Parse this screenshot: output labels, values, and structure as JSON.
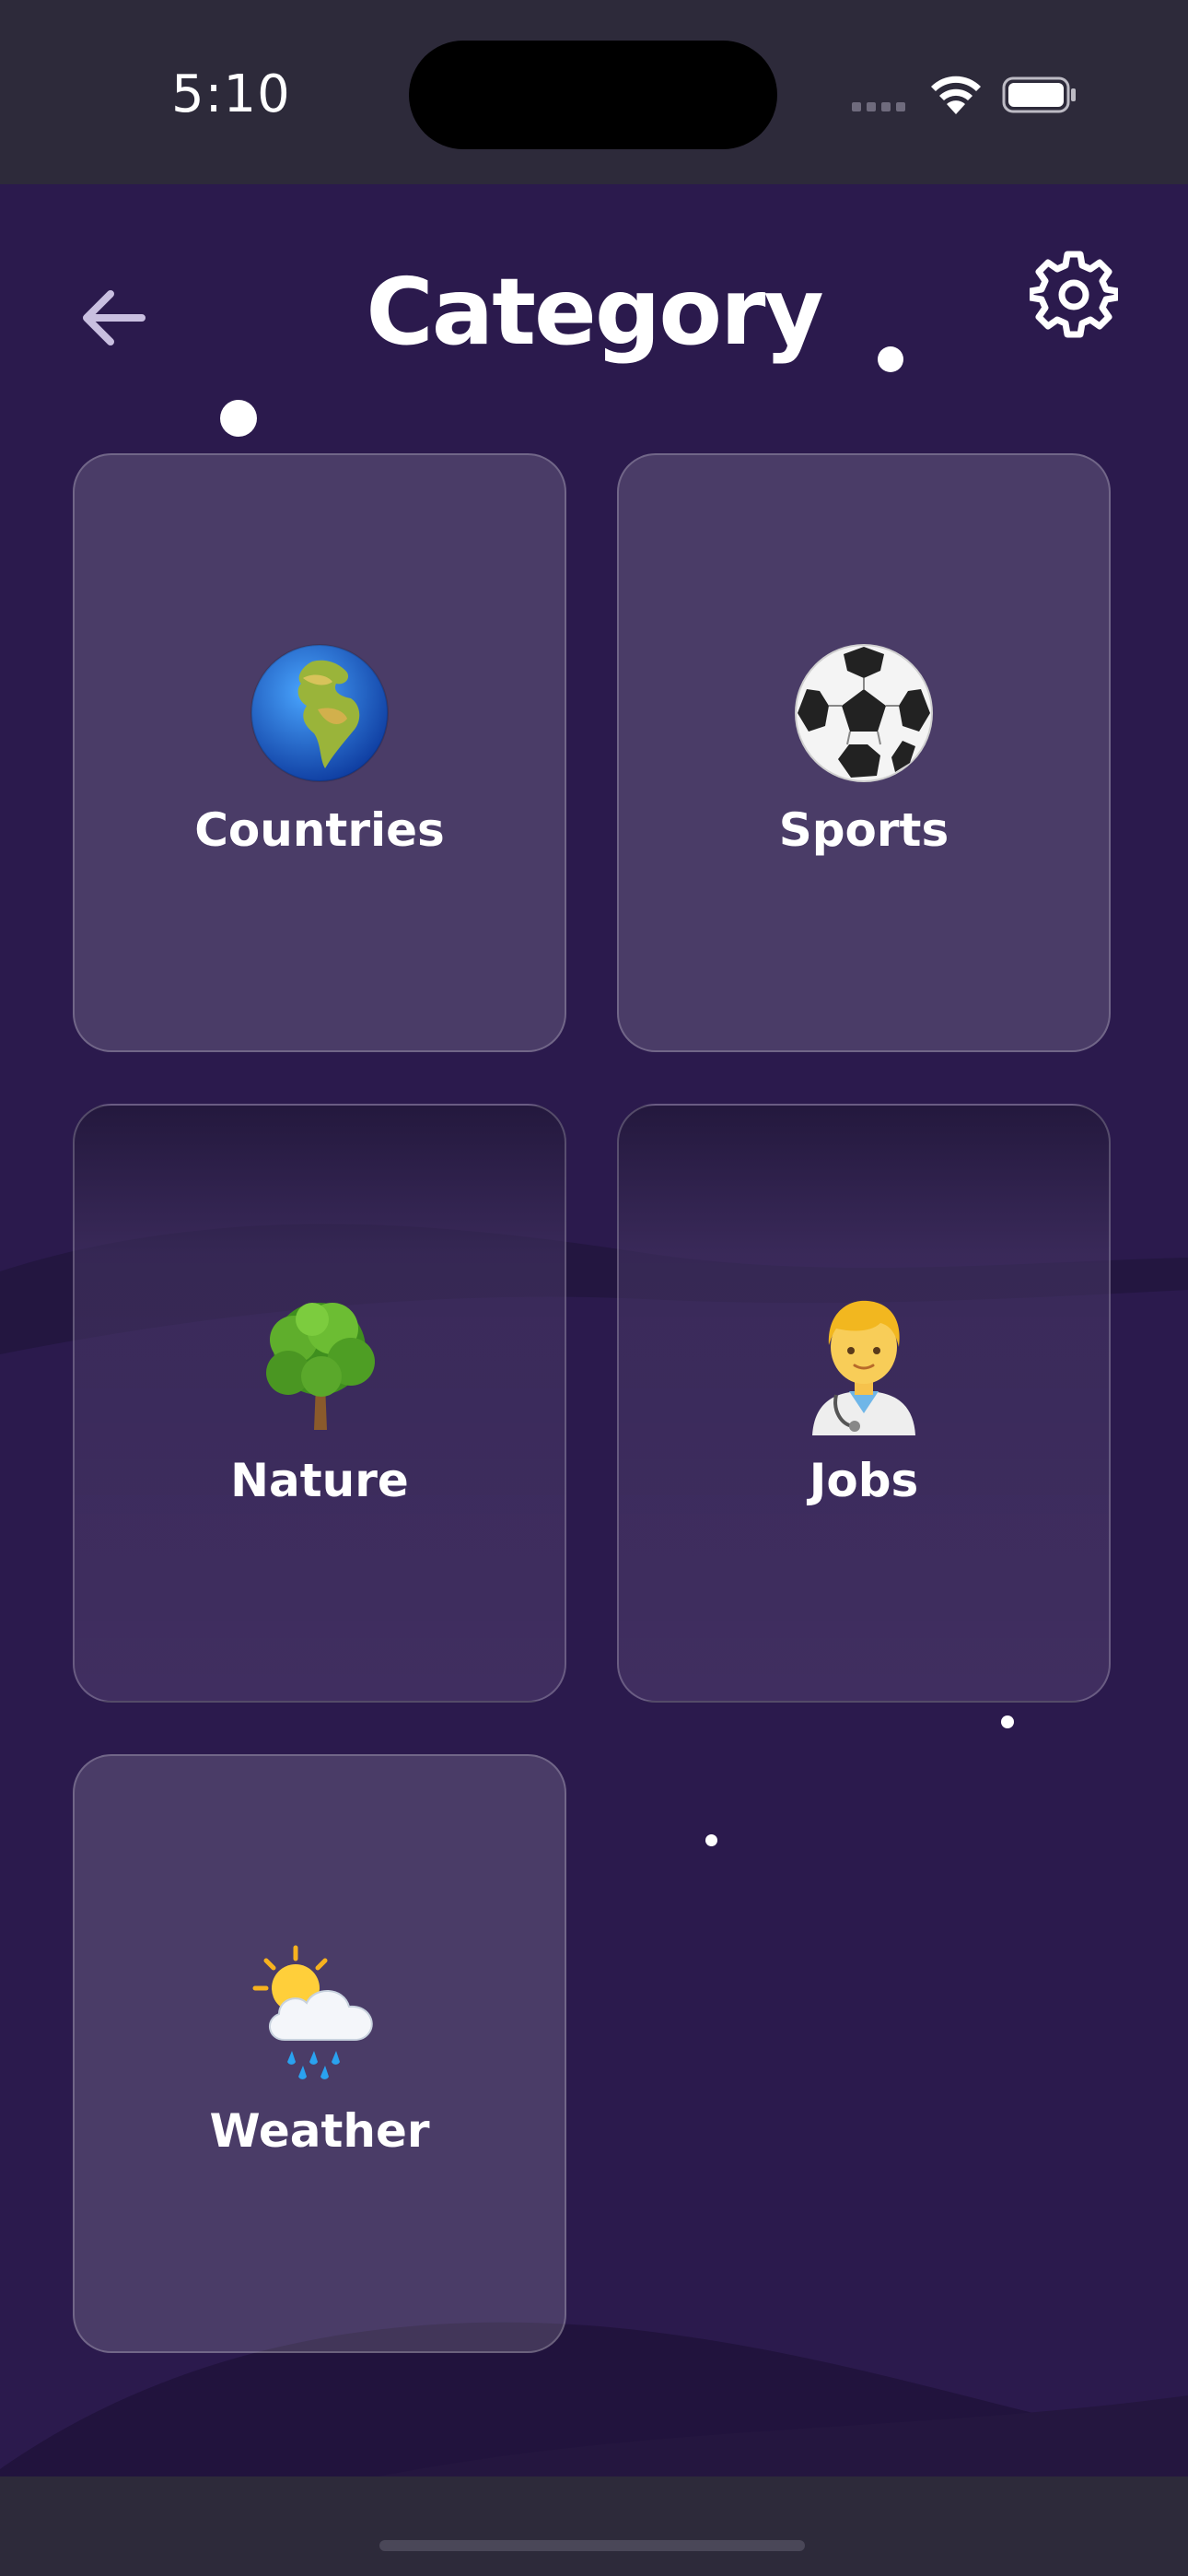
{
  "status_bar": {
    "time": "5:10"
  },
  "header": {
    "title": "Category",
    "back_icon": "arrow-left-icon",
    "settings_icon": "gear-icon"
  },
  "categories": [
    {
      "label": "Countries",
      "icon": "globe-europe-africa-emoji"
    },
    {
      "label": "Sports",
      "icon": "soccer-ball-emoji"
    },
    {
      "label": "Nature",
      "icon": "deciduous-tree-emoji"
    },
    {
      "label": "Jobs",
      "icon": "health-worker-emoji"
    },
    {
      "label": "Weather",
      "icon": "sun-behind-rain-cloud-emoji"
    }
  ],
  "colors": {
    "background": "#2b1a4d",
    "card": "#4e3d6b",
    "text": "#ffffff",
    "system_bar": "#2d2a3a"
  }
}
